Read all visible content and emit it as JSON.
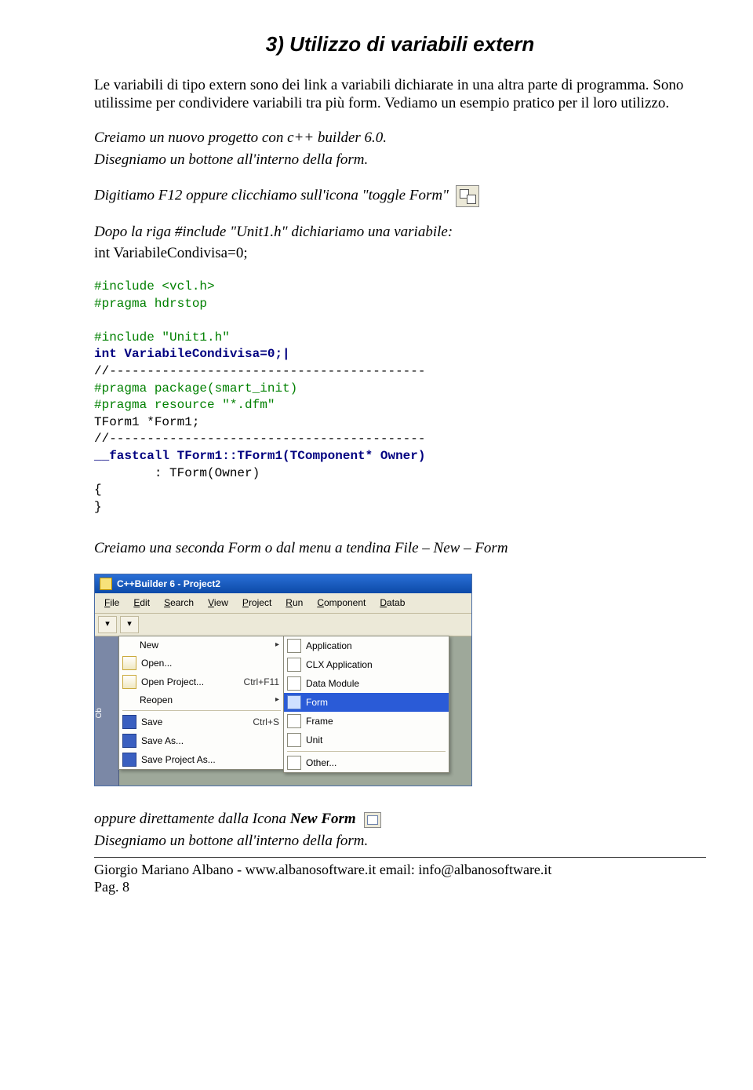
{
  "title": "3) Utilizzo di variabili extern",
  "para1a": "Le variabili di tipo extern sono dei link a variabili dichiarate in una altra parte di programma. Sono utilissime per condividere variabili tra più form. Vediamo un esempio pratico per il loro utilizzo.",
  "para2a": "Creiamo un nuovo progetto con c++ builder 6.0.",
  "para2b": "Disegniamo un bottone all'interno della form.",
  "para3": "Digitiamo F12 oppure clicchiamo sull'icona \"toggle Form\"",
  "para4a": "Dopo la riga #include \"Unit1.h\" dichiariamo una variabile:",
  "para4b": "int VariabileCondivisa=0;",
  "code": {
    "l1": "#include <vcl.h>",
    "l2": "#pragma hdrstop",
    "l3": "#include \"Unit1.h\"",
    "l4": "int VariabileCondivisa=0;|",
    "l5": "//------------------------------------------",
    "l6": "#pragma package(smart_init)",
    "l7": "#pragma resource \"*.dfm\"",
    "l8": "TForm1 *Form1;",
    "l9": "//------------------------------------------",
    "l10": "__fastcall TForm1::TForm1(TComponent* Owner)",
    "l11": "        : TForm(Owner)",
    "l12": "{",
    "l13": "}"
  },
  "para5": "Creiamo una seconda Form o dal menu a tendina File – New – Form",
  "win": {
    "title": "C++Builder 6 - Project2",
    "menubar": [
      "File",
      "Edit",
      "Search",
      "View",
      "Project",
      "Run",
      "Component",
      "Datab"
    ],
    "file_menu": {
      "new": "New",
      "open": "Open...",
      "open_project": "Open Project...",
      "open_project_sc": "Ctrl+F11",
      "reopen": "Reopen",
      "save": "Save",
      "save_sc": "Ctrl+S",
      "save_as": "Save As...",
      "save_project_as": "Save Project As..."
    },
    "new_sub": {
      "application": "Application",
      "clx_application": "CLX Application",
      "data_module": "Data Module",
      "form": "Form",
      "frame": "Frame",
      "unit": "Unit",
      "other": "Other..."
    },
    "sidepane": "Ob"
  },
  "para6a": "oppure direttamente dalla Icona ",
  "para6b": "New Form",
  "para7": "Disegniamo un bottone all'interno della form.",
  "footer": {
    "left": "Giorgio Mariano Albano  - www.albanosoftware.it           email: info@albanosoftware.it",
    "page": "Pag. 8"
  }
}
